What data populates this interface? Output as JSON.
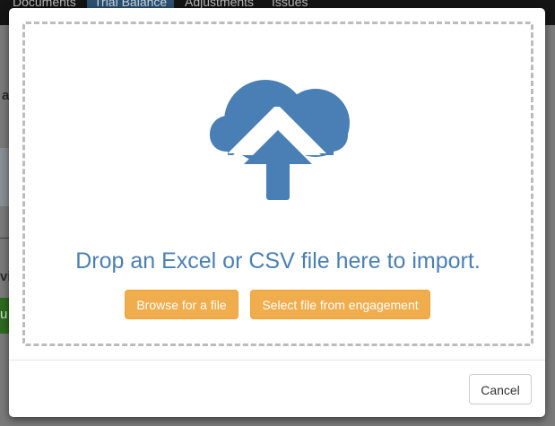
{
  "background": {
    "nav_items": [
      "Documents",
      "Trial Balance",
      "Adjustments",
      "Issues"
    ],
    "active_nav_index": 1,
    "partial_text_1": "a",
    "partial_text_2": "vi",
    "partial_text_3": "u"
  },
  "modal": {
    "drop_title": "Drop an Excel or CSV file here to import.",
    "browse_label": "Browse for a file",
    "select_label": "Select file from engagement",
    "cancel_label": "Cancel",
    "icon": "cloud-upload-icon"
  },
  "colors": {
    "accent": "#4a7fb5",
    "warning_button": "#f0ad4e",
    "dashed_border": "#bcbcbc"
  }
}
